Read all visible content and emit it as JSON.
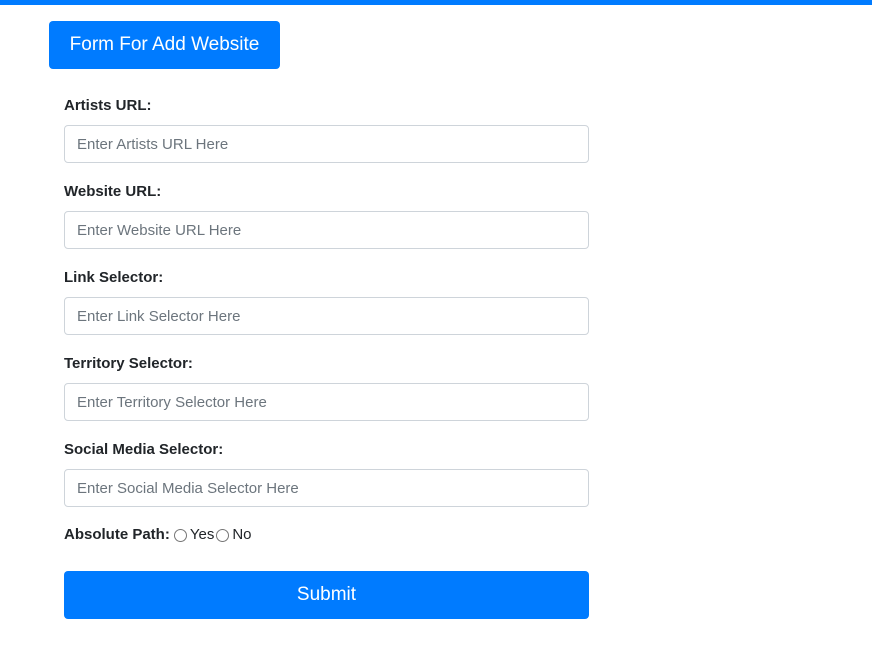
{
  "header": {
    "title_button_label": "Form For Add Website"
  },
  "form": {
    "fields": [
      {
        "label": "Artists URL:",
        "placeholder": "Enter Artists URL Here",
        "value": ""
      },
      {
        "label": "Website URL:",
        "placeholder": "Enter Website URL Here",
        "value": ""
      },
      {
        "label": "Link Selector:",
        "placeholder": "Enter Link Selector Here",
        "value": ""
      },
      {
        "label": "Territory Selector:",
        "placeholder": "Enter Territory Selector Here",
        "value": ""
      },
      {
        "label": "Social Media Selector:",
        "placeholder": "Enter Social Media Selector Here",
        "value": ""
      }
    ],
    "absolute_path": {
      "label": "Absolute Path:",
      "options": [
        "Yes",
        "No"
      ],
      "selected": null
    },
    "submit_label": "Submit"
  },
  "colors": {
    "primary": "#007bff",
    "input_border": "#ced4da",
    "text": "#212529",
    "placeholder": "#6c757d"
  }
}
